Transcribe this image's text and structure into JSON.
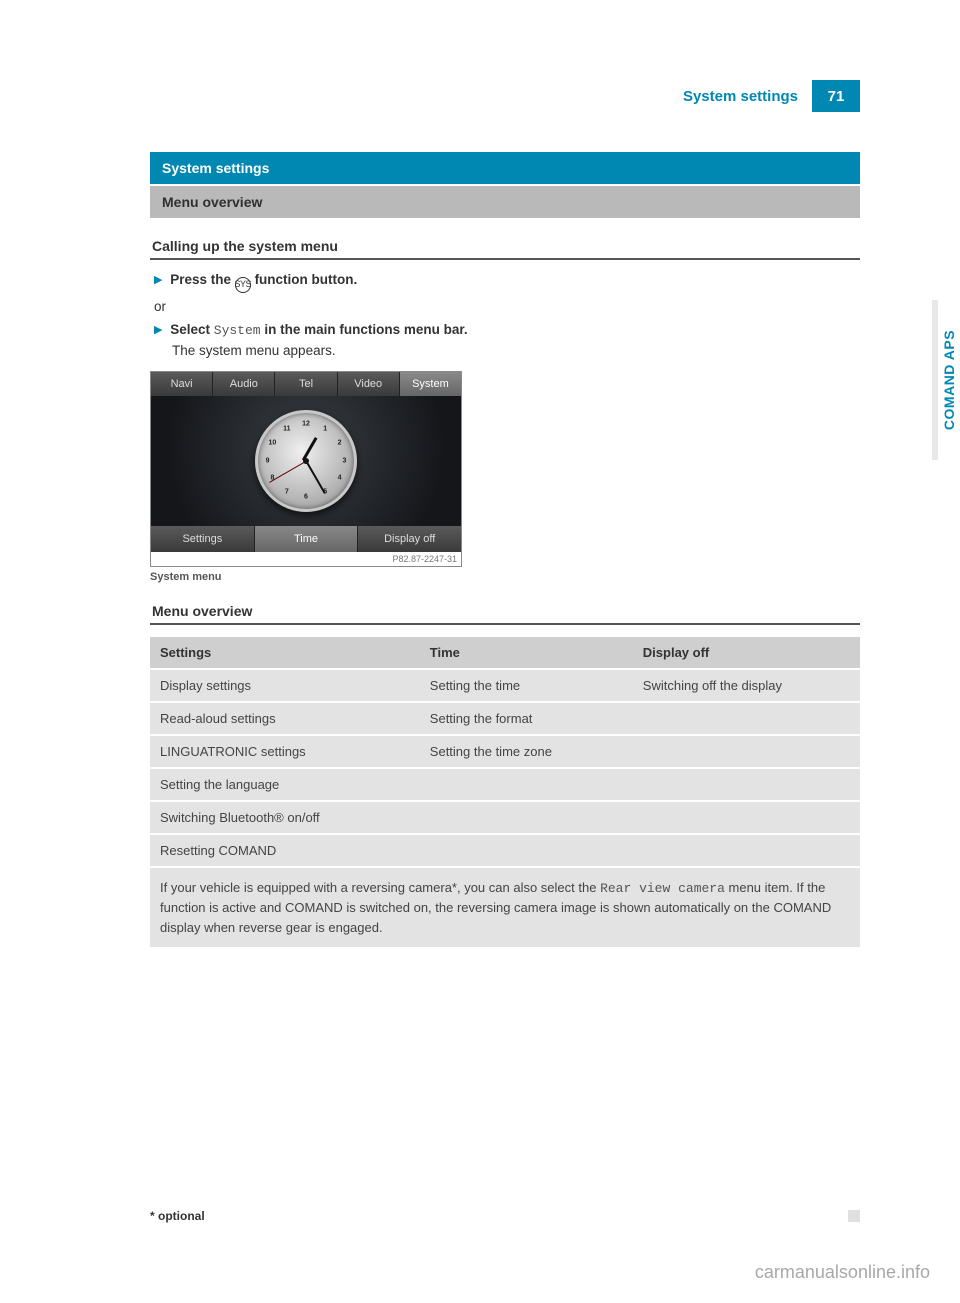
{
  "header": {
    "title": "System settings",
    "page": "71"
  },
  "side_tab": "COMAND APS",
  "section_band": "System settings",
  "subsection_band": "Menu overview",
  "sub1": "Calling up the system menu",
  "step1_prefix": "Press the",
  "step1_icon": "SYS",
  "step1_suffix": "function button.",
  "or": "or",
  "step2_prefix": "Select",
  "step2_sys": "System",
  "step2_suffix": "in the main functions menu bar.",
  "step2_result": "The system menu appears.",
  "screenshot": {
    "top_tabs": [
      "Navi",
      "Audio",
      "Tel",
      "Video",
      "System"
    ],
    "top_selected": 4,
    "bottom_tabs": [
      "Settings",
      "Time",
      "Display off"
    ],
    "bottom_selected": 1,
    "clock_numbers": [
      "12",
      "1",
      "2",
      "3",
      "4",
      "5",
      "6",
      "7",
      "8",
      "9",
      "10",
      "11"
    ],
    "code": "P82.87-2247-31"
  },
  "caption": "System menu",
  "sub2": "Menu overview",
  "table": {
    "headers": [
      "Settings",
      "Time",
      "Display off"
    ],
    "rows": [
      [
        "Display settings",
        "Setting the time",
        "Switching off the display"
      ],
      [
        "Read-aloud settings",
        "Setting the format",
        ""
      ],
      [
        "LINGUATRONIC settings",
        "Setting the time zone",
        ""
      ],
      [
        "Setting the language",
        "",
        ""
      ],
      [
        "Switching Bluetooth® on/off",
        "",
        ""
      ],
      [
        "Resetting COMAND",
        "",
        ""
      ]
    ],
    "note_pre": "If your vehicle is equipped with a reversing camera*, you can also select the ",
    "note_mono": "Rear view camera",
    "note_post": " menu item. If the function is active and COMAND is switched on, the reversing camera image is shown automatically on the COMAND display when reverse gear is engaged."
  },
  "footer_note": "* optional",
  "watermark": "carmanualsonline.info"
}
